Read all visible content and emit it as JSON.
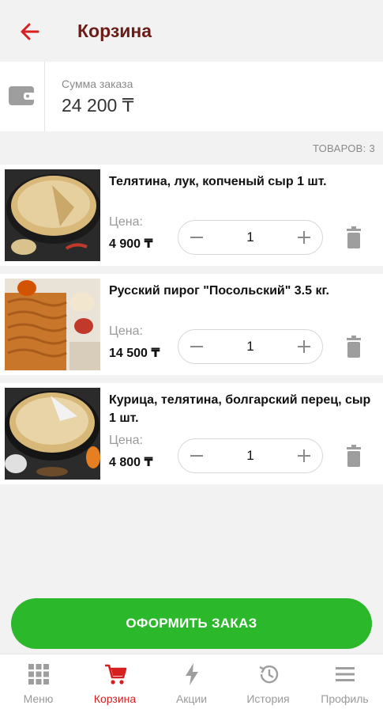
{
  "header": {
    "title": "Корзина"
  },
  "summary": {
    "label": "Сумма заказа",
    "value": "24 200 ₸"
  },
  "items_count": "ТОВАРОВ: 3",
  "cart": [
    {
      "name": "Телятина, лук, копченый сыр 1 шт.",
      "price_label": "Цена:",
      "price": "4 900 ₸",
      "quantity": "1"
    },
    {
      "name": "Русский пирог \"Посольский\" 3.5 кг.",
      "price_label": "Цена:",
      "price": "14 500 ₸",
      "quantity": "1"
    },
    {
      "name": "Курица, телятина, болгарский перец, сыр 1 шт.",
      "price_label": "Цена:",
      "price": "4 800 ₸",
      "quantity": "1"
    }
  ],
  "checkout": {
    "label": "ОФОРМИТЬ ЗАКАЗ"
  },
  "nav": [
    {
      "label": "Меню",
      "icon": "grid-icon"
    },
    {
      "label": "Корзина",
      "icon": "cart-icon",
      "active": true
    },
    {
      "label": "Акции",
      "icon": "lightning-icon"
    },
    {
      "label": "История",
      "icon": "history-icon"
    },
    {
      "label": "Профиль",
      "icon": "menu-icon"
    }
  ],
  "colors": {
    "accent": "#d81f1f",
    "title": "#6b1d17",
    "checkout": "#2bb82b",
    "inactive": "#9a9a9a"
  }
}
